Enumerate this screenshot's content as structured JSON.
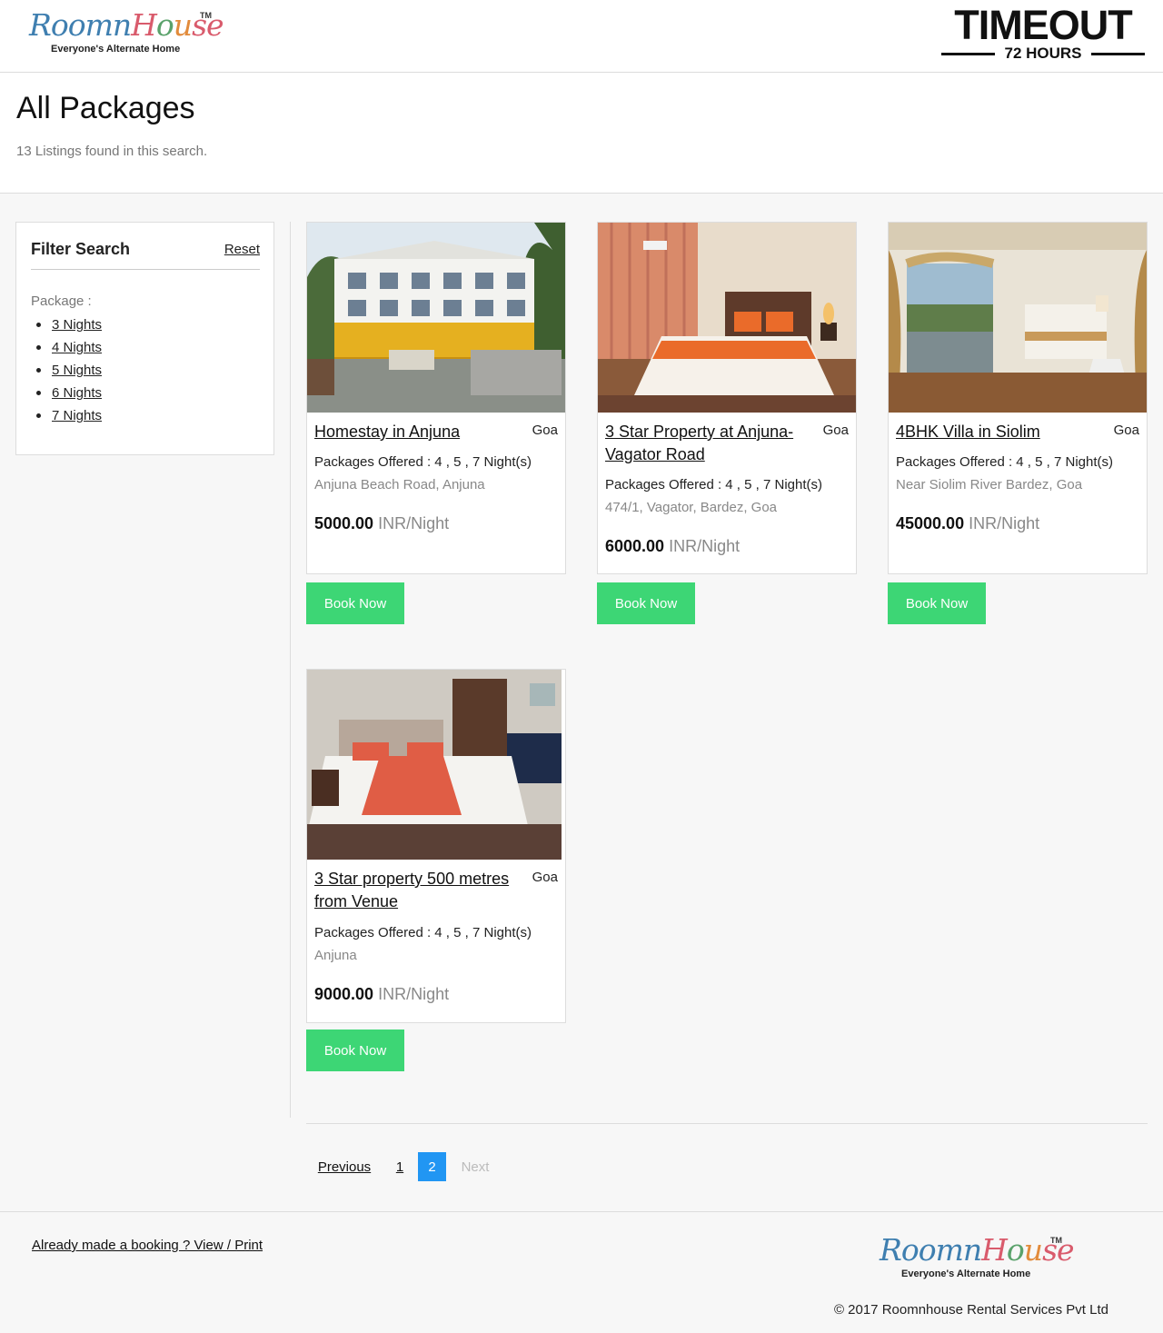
{
  "header": {
    "logo": {
      "name": "RoomnHouse",
      "trademark": "TM",
      "tagline": "Everyone's Alternate Home"
    },
    "partner_logo": {
      "word": "TIMEOUT",
      "sub": "72 HOURS"
    }
  },
  "title": {
    "heading": "All Packages",
    "subtitle": "13 Listings found in this search."
  },
  "filter": {
    "title": "Filter Search",
    "reset": "Reset",
    "package_label": "Package :",
    "options": [
      "3 Nights",
      "4 Nights",
      "5 Nights",
      "6 Nights",
      "7 Nights"
    ]
  },
  "listings": [
    {
      "title": "Homestay in Anjuna",
      "location": "Goa",
      "packages": "Packages Offered : 4 , 5 , 7 Night(s)",
      "address": "Anjuna Beach Road, Anjuna",
      "price": "5000.00",
      "unit": "INR/Night",
      "button": "Book Now",
      "photo": "hotel-exterior-photo"
    },
    {
      "title": "3 Star Property at Anjuna-Vagator Road",
      "location": "Goa",
      "packages": "Packages Offered : 4 , 5 , 7 Night(s)",
      "address": "474/1, Vagator, Bardez, Goa",
      "price": "6000.00",
      "unit": "INR/Night",
      "button": "Book Now",
      "photo": "hotel-room-photo"
    },
    {
      "title": "4BHK Villa in Siolim",
      "location": "Goa",
      "packages": "Packages Offered : 4 , 5 , 7 Night(s)",
      "address": "Near Siolim River Bardez, Goa",
      "price": "45000.00",
      "unit": "INR/Night",
      "button": "Book Now",
      "photo": "villa-bedroom-photo"
    },
    {
      "title": "3 Star property 500 metres from Venue",
      "location": "Goa",
      "packages": "Packages Offered : 4 , 5 , 7 Night(s)",
      "address": "Anjuna",
      "price": "9000.00",
      "unit": "INR/Night",
      "button": "Book Now",
      "photo": "hotel-bedroom-photo"
    }
  ],
  "pagination": {
    "previous": "Previous",
    "pages": [
      "1",
      "2"
    ],
    "current": "2",
    "next": "Next"
  },
  "footer": {
    "booking_link": "Already made a booking ? View / Print",
    "copyright": "© 2017 Roomnhouse Rental Services Pvt Ltd"
  },
  "colors": {
    "accent_button": "#3dd675",
    "active_page": "#2196f3"
  }
}
